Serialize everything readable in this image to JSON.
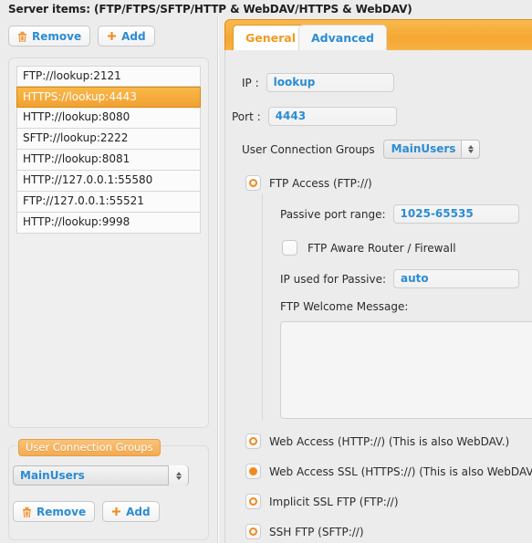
{
  "window": {
    "title": "Server items: (FTP/FTPS/SFTP/HTTP & WebDAV/HTTPS & WebDAV)"
  },
  "colors": {
    "accent_orange": "#f08a1e",
    "selection_orange": "#f2a032",
    "link_blue": "#2b8cd4",
    "panel_bg": "#ececec"
  },
  "left_panel": {
    "toolbar": {
      "remove_label": "Remove",
      "remove_icon": "trash-icon",
      "add_label": "Add",
      "add_icon": "plus-icon"
    },
    "server_items": [
      {
        "label": "FTP://lookup:2121",
        "selected": false
      },
      {
        "label": "HTTPS://lookup:4443",
        "selected": true
      },
      {
        "label": "HTTP://lookup:8080",
        "selected": false
      },
      {
        "label": "SFTP://lookup:2222",
        "selected": false
      },
      {
        "label": "HTTP://lookup:8081",
        "selected": false
      },
      {
        "label": "HTTP://127.0.0.1:55580",
        "selected": false
      },
      {
        "label": "FTP://127.0.0.1:55521",
        "selected": false
      },
      {
        "label": "HTTP://lookup:9998",
        "selected": false
      }
    ],
    "user_connection_groups": {
      "legend": "User Connection Groups",
      "selected_value": "MainUsers",
      "remove_label": "Remove",
      "remove_icon": "trash-icon",
      "add_label": "Add",
      "add_icon": "plus-icon"
    }
  },
  "right_panel": {
    "tabs": [
      {
        "label": "General",
        "active": true
      },
      {
        "label": "Advanced",
        "active": false
      }
    ],
    "fields": {
      "ip_label": "IP :",
      "ip_value": "lookup",
      "port_label": "Port :",
      "port_value": "4443",
      "ucg_label": "User Connection Groups",
      "ucg_value": "MainUsers"
    },
    "ftp_access": {
      "label": "FTP Access (FTP://)",
      "selected": false,
      "passive_port_label": "Passive port range:",
      "passive_port_value": "1025-65535",
      "aware_router_label": "FTP Aware Router / Firewall",
      "aware_router_checked": false,
      "passive_ip_label": "IP used for Passive:",
      "passive_ip_value": "auto",
      "welcome_label": "FTP Welcome Message:",
      "welcome_value": ""
    },
    "access_options": [
      {
        "label": "Web Access (HTTP://) (This is also WebDAV.)",
        "selected": false
      },
      {
        "label": "Web Access SSL (HTTPS://) (This is also WebDAV.)",
        "selected": true
      },
      {
        "label": "Implicit SSL FTP (FTP://)",
        "selected": false
      },
      {
        "label": "SSH FTP (SFTP://)",
        "selected": false
      }
    ]
  }
}
